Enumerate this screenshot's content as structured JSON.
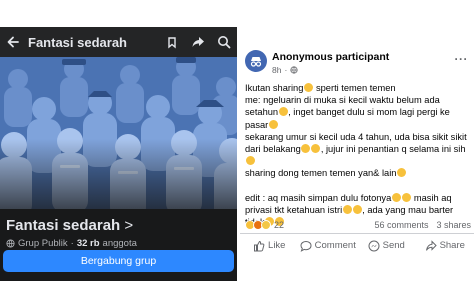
{
  "group_page": {
    "header_title": "Fantasi sedarah",
    "group_name": "Fantasi sedarah",
    "group_name_chevron": ">",
    "privacy": "Grup Publik",
    "separator": "·",
    "member_count": "32 rb",
    "member_label": "anggota",
    "more_members": "···",
    "join_label": "Bergabung grup"
  },
  "post": {
    "author": "Anonymous participant",
    "time": "8h",
    "menu": "···",
    "paragraphs": [
      {
        "text": "Ikutan sharing",
        "emoji_after": 1
      },
      {
        "text": " sperti temen temen",
        "emoji_after": 0
      },
      {
        "text": "me: ngeluarin di muka si kecil waktu belum ada setahun",
        "emoji_after": 1
      },
      {
        "text": ", inget banget dulu si mom lagi pergi ke pasar",
        "emoji_after": 1
      },
      {
        "text": "sekarang umur si kecil uda 4 tahun, uda bisa sikit sikit dari belakang",
        "emoji_after": 2
      },
      {
        "text": ", jujur ini penantian q selama ini sih",
        "emoji_after": 1
      },
      {
        "text": "sharing dong temen temen yan& lain",
        "emoji_after": 1
      },
      {
        "text": "edit : aq masih simpan dulu fotonya",
        "emoji_after": 2
      },
      {
        "text": " masih aq privasi tkt ketahuan istri",
        "emoji_after": 2
      },
      {
        "text": ", ada yang mau barter tidak",
        "emoji_after": 2
      }
    ],
    "reaction_count": "22",
    "comments": "56 comments",
    "shares": "3 shares",
    "actions": {
      "like": "Like",
      "comment": "Comment",
      "send": "Send",
      "share": "Share"
    }
  },
  "colors": {
    "dark_bg": "#18191a",
    "cover_blue": "#4b73b3",
    "fb_blue": "#2d88ff",
    "text_secondary": "#65676b"
  }
}
